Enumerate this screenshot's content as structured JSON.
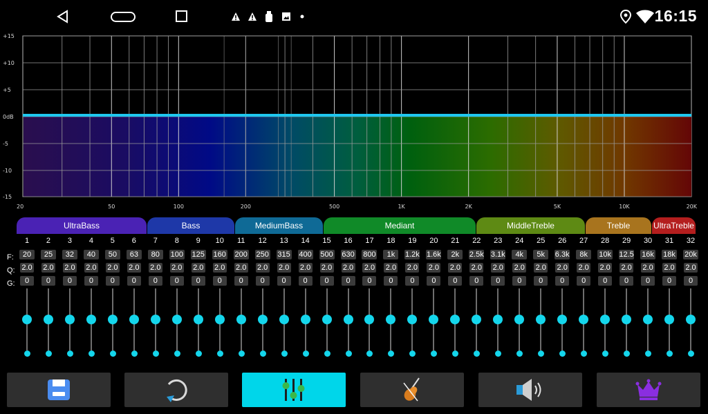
{
  "status_bar": {
    "time": "16:15",
    "nav_icons": [
      "back-icon",
      "home-icon",
      "recents-icon"
    ],
    "notification_icons": [
      "warning-icon",
      "warning-icon",
      "usb-icon",
      "image-icon",
      "dot-icon"
    ],
    "system_icons": [
      "location-icon",
      "wifi-icon"
    ]
  },
  "graph": {
    "db_labels": [
      "+15",
      "+10",
      "+5",
      "0dB",
      "-5",
      "-10",
      "-15"
    ],
    "freq_labels": [
      "20",
      "50",
      "100",
      "200",
      "500",
      "1K",
      "2K",
      "5K",
      "10K",
      "20K"
    ],
    "curve_color": "#1ec8f0"
  },
  "bands": [
    {
      "label": "UltraBass",
      "color": "#4a22b4"
    },
    {
      "label": "Bass",
      "color": "#1e38a8"
    },
    {
      "label": "MediumBass",
      "color": "#0f6a96"
    },
    {
      "label": "Mediant",
      "color": "#108a28"
    },
    {
      "label": "MiddleTreble",
      "color": "#5e8a14"
    },
    {
      "label": "Treble",
      "color": "#a8741e"
    },
    {
      "label": "UltraTreble",
      "color": "#b41e1e"
    }
  ],
  "row_labels": {
    "f": "F:",
    "q": "Q:",
    "g": "G:"
  },
  "channels": {
    "numbers": [
      "1",
      "2",
      "3",
      "4",
      "5",
      "6",
      "7",
      "8",
      "9",
      "10",
      "11",
      "12",
      "13",
      "14",
      "15",
      "16",
      "17",
      "18",
      "19",
      "20",
      "21",
      "22",
      "23",
      "24",
      "25",
      "26",
      "27",
      "28",
      "29",
      "30",
      "31",
      "32"
    ],
    "freqs": [
      "20",
      "25",
      "32",
      "40",
      "50",
      "63",
      "80",
      "100",
      "125",
      "160",
      "200",
      "250",
      "315",
      "400",
      "500",
      "630",
      "800",
      "1k",
      "1.2k",
      "1.6k",
      "2k",
      "2.5k",
      "3.1k",
      "4k",
      "5k",
      "6.3k",
      "8k",
      "10k",
      "12.5",
      "16k",
      "18k",
      "20k"
    ],
    "q": [
      "2.0",
      "2.0",
      "2.0",
      "2.0",
      "2.0",
      "2.0",
      "2.0",
      "2.0",
      "2.0",
      "2.0",
      "2.0",
      "2.0",
      "2.0",
      "2.0",
      "2.0",
      "2.0",
      "2.0",
      "2.0",
      "2.0",
      "2.0",
      "2.0",
      "2.0",
      "2.0",
      "2.0",
      "2.0",
      "2.0",
      "2.0",
      "2.0",
      "2.0",
      "2.0",
      "2.0",
      "2.0"
    ],
    "gain": [
      "0",
      "0",
      "0",
      "0",
      "0",
      "0",
      "0",
      "0",
      "0",
      "0",
      "0",
      "0",
      "0",
      "0",
      "0",
      "0",
      "0",
      "0",
      "0",
      "0",
      "0",
      "0",
      "0",
      "0",
      "0",
      "0",
      "0",
      "0",
      "0",
      "0",
      "0",
      "0"
    ],
    "slider_level": [
      0.5,
      0.5,
      0.5,
      0.5,
      0.5,
      0.5,
      0.5,
      0.5,
      0.5,
      0.5,
      0.5,
      0.5,
      0.5,
      0.5,
      0.5,
      0.5,
      0.5,
      0.5,
      0.5,
      0.5,
      0.5,
      0.5,
      0.5,
      0.5,
      0.5,
      0.5,
      0.5,
      0.5,
      0.5,
      0.5,
      0.5,
      0.5
    ],
    "accent": "#14d6ec"
  },
  "toolbar": [
    {
      "icon": "save-icon",
      "active": false
    },
    {
      "icon": "reset-icon",
      "active": false
    },
    {
      "icon": "equalizer-icon",
      "active": true
    },
    {
      "icon": "violin-icon",
      "active": false
    },
    {
      "icon": "speaker-icon",
      "active": false
    },
    {
      "icon": "crown-icon",
      "active": false
    }
  ]
}
